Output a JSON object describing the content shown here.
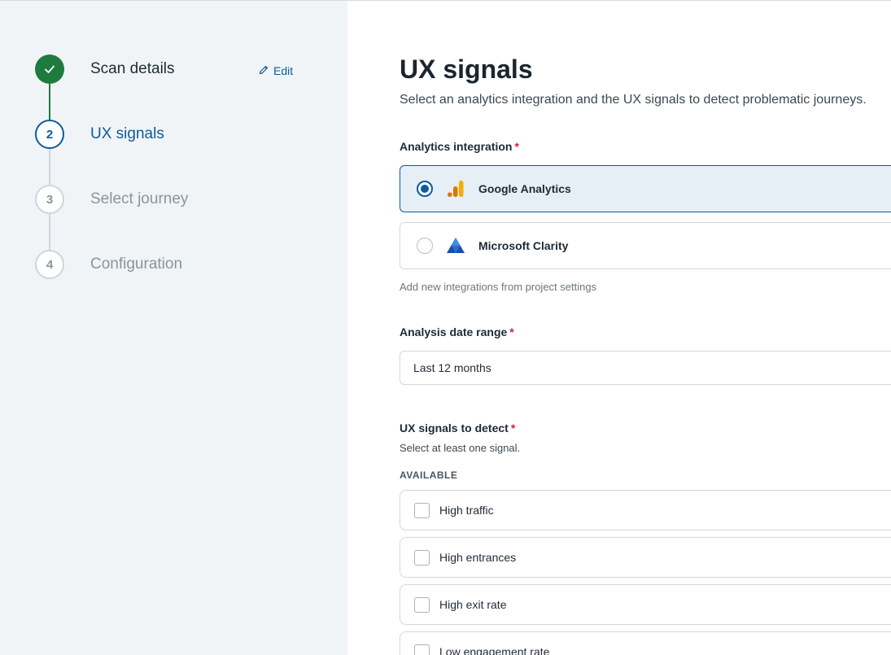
{
  "stepper": {
    "steps": [
      {
        "number": "✓",
        "label": "Scan details",
        "state": "done"
      },
      {
        "number": "2",
        "label": "UX signals",
        "state": "active"
      },
      {
        "number": "3",
        "label": "Select journey",
        "state": "pending"
      },
      {
        "number": "4",
        "label": "Configuration",
        "state": "pending"
      }
    ],
    "edit_label": "Edit"
  },
  "main": {
    "title": "UX signals",
    "subtitle": "Select an analytics integration and the UX signals to detect problematic journeys.",
    "analytics": {
      "label": "Analytics integration",
      "required_mark": "*",
      "options": [
        {
          "label": "Google Analytics",
          "icon": "google-analytics-icon",
          "selected": true
        },
        {
          "label": "Microsoft Clarity",
          "icon": "microsoft-clarity-icon",
          "selected": false
        }
      ],
      "hint": "Add new integrations from project settings"
    },
    "date_range": {
      "label": "Analysis date range",
      "required_mark": "*",
      "value": "Last 12 months"
    },
    "signals": {
      "label": "UX signals to detect",
      "required_mark": "*",
      "hint": "Select at least one signal.",
      "section_caption": "AVAILABLE",
      "items": [
        {
          "label": "High traffic",
          "checked": false
        },
        {
          "label": "High entrances",
          "checked": false
        },
        {
          "label": "High exit rate",
          "checked": false
        },
        {
          "label": "Low engagement rate",
          "checked": false
        }
      ]
    }
  },
  "colors": {
    "primary": "#0f5a9c",
    "success": "#1f7a3f",
    "required": "#d1242f",
    "sidebar_bg": "#f0f4f6"
  }
}
